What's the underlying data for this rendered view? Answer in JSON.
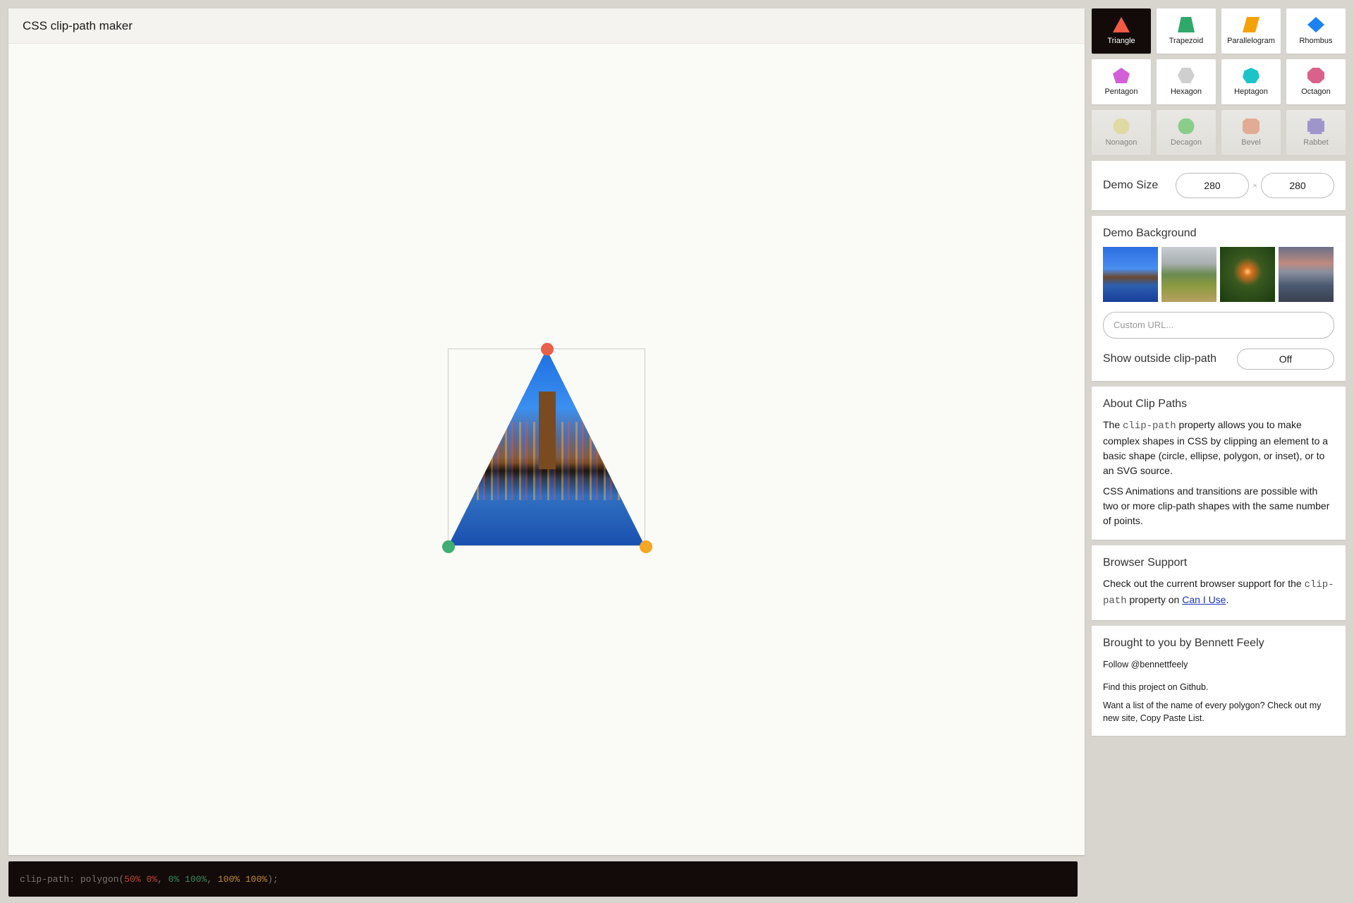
{
  "header": {
    "title": "CSS clip-path maker"
  },
  "code": {
    "prefix": "clip-path: polygon(",
    "p1": "50% 0%",
    "sep1": ", ",
    "p2": "0% 100%",
    "sep2": ", ",
    "p3": "100% 100%",
    "suffix": ");"
  },
  "colors": {
    "p1": "#e8604a",
    "p2": "#3fae72",
    "p3": "#f5a623"
  },
  "shapes": [
    {
      "label": "Triangle",
      "color": "#f25a43",
      "clip": "polygon(50% 0,0 100%,100% 100%)"
    },
    {
      "label": "Trapezoid",
      "color": "#2fa86a",
      "clip": "polygon(20% 0,80% 0,100% 100%,0 100%)"
    },
    {
      "label": "Parallelogram",
      "color": "#f5a20a",
      "clip": "polygon(25% 0,100% 0,75% 100%,0 100%)"
    },
    {
      "label": "Rhombus",
      "color": "#1b82f0",
      "clip": "polygon(50% 0,100% 50%,50% 100%,0 50%)"
    },
    {
      "label": "Pentagon",
      "color": "#d35fd8",
      "clip": "polygon(50% 0,100% 38%,82% 100%,18% 100%,0 38%)"
    },
    {
      "label": "Hexagon",
      "color": "#cfcfcf",
      "clip": "polygon(25% 0,75% 0,100% 50%,75% 100%,25% 100%,0 50%)"
    },
    {
      "label": "Heptagon",
      "color": "#1cc4c8",
      "clip": "polygon(50% 0,90% 20%,100% 60%,75% 100%,25% 100%,0 60%,10% 20%)"
    },
    {
      "label": "Octagon",
      "color": "#d9628a",
      "clip": "polygon(30% 0,70% 0,100% 30%,100% 70%,70% 100%,30% 100%,0 70%,0 30%)"
    },
    {
      "label": "Nonagon",
      "color": "#e8e070",
      "clip": "circle(50%)"
    },
    {
      "label": "Decagon",
      "color": "#2ec43a",
      "clip": "circle(50%)"
    },
    {
      "label": "Bevel",
      "color": "#f07a50",
      "clip": "polygon(20% 0,80% 0,100% 20%,100% 80%,80% 100%,20% 100%,0 80%,0 20%)"
    },
    {
      "label": "Rabbet",
      "color": "#5a48c8",
      "clip": "polygon(15% 0,85% 0,85% 15%,100% 15%,100% 85%,85% 85%,85% 100%,15% 100%,15% 85%,0 85%,0 15%,15% 15%)"
    }
  ],
  "size": {
    "label": "Demo Size",
    "width": "280",
    "height": "280",
    "times": "×"
  },
  "background": {
    "title": "Demo Background",
    "url_placeholder": "Custom URL...",
    "outside_label": "Show outside clip-path",
    "outside_value": "Off"
  },
  "about": {
    "title": "About Clip Paths",
    "p1_a": "The ",
    "p1_code": "clip-path",
    "p1_b": " property allows you to make complex shapes in CSS by clipping an element to a basic shape (circle, ellipse, polygon, or inset), or to an SVG source.",
    "p2": "CSS Animations and transitions are possible with two or more clip-path shapes with the same number of points."
  },
  "support": {
    "title": "Browser Support",
    "a": "Check out the current browser support for the ",
    "code": "clip-path",
    "b": " property on ",
    "link": "Can I Use",
    "c": "."
  },
  "credits": {
    "title": "Brought to you by Bennett Feely",
    "follow": "Follow @bennettfeely",
    "github": "Find this project on Github.",
    "list": "Want a list of the name of every polygon? Check out my new site, Copy Paste List."
  }
}
